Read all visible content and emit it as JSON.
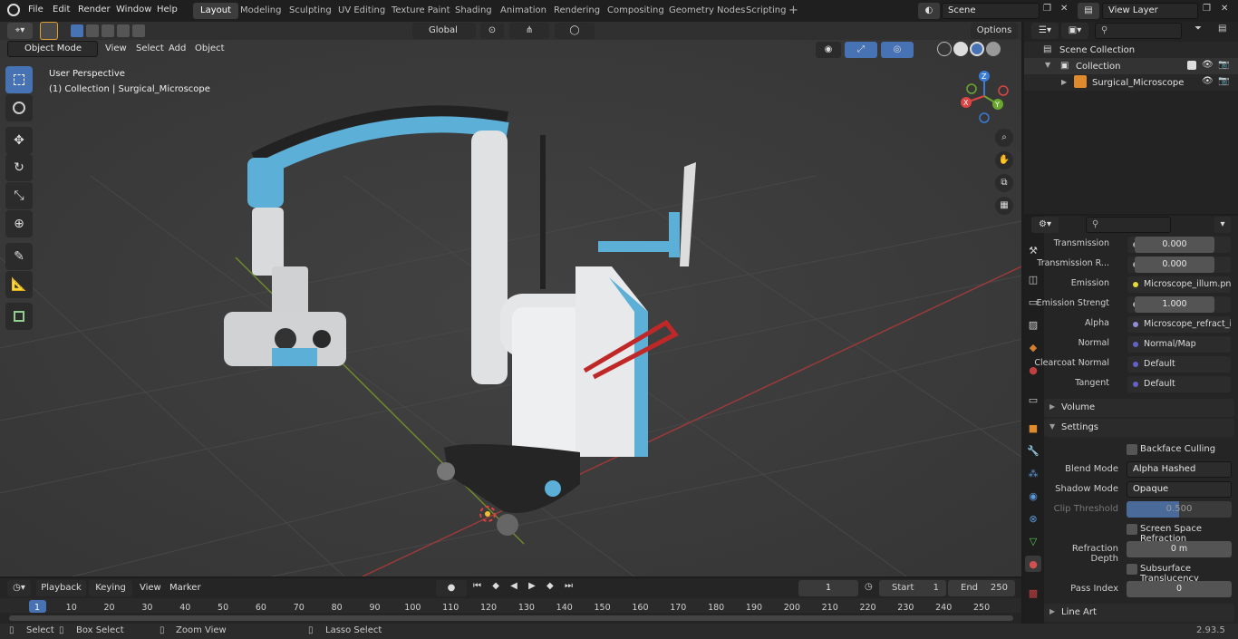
{
  "menus": [
    "File",
    "Edit",
    "Render",
    "Window",
    "Help"
  ],
  "workspaces": [
    "Layout",
    "Modeling",
    "Sculpting",
    "UV Editing",
    "Texture Paint",
    "Shading",
    "Animation",
    "Rendering",
    "Compositing",
    "Geometry Nodes",
    "Scripting"
  ],
  "scene": "Scene",
  "view_layer": "View Layer",
  "vp": {
    "mode": "Object Mode",
    "view": "View",
    "select": "Select",
    "add": "Add",
    "object": "Object",
    "orientation": "Global",
    "options": "Options",
    "overlay_title": "User Perspective",
    "overlay_sub": "(1) Collection | Surgical_Microscope"
  },
  "gizmo": {
    "x": "X",
    "y": "Y",
    "z": "Z"
  },
  "outliner": {
    "scene_collection": "Scene Collection",
    "collection": "Collection",
    "object": "Surgical_Microscope"
  },
  "props": {
    "rows": [
      {
        "label": "Transmission",
        "value": "0.000",
        "type": "num"
      },
      {
        "label": "Transmission R...",
        "value": "0.000",
        "type": "num"
      },
      {
        "label": "Emission",
        "value": "Microscope_illum.png",
        "type": "link",
        "color": "#e6d93a"
      },
      {
        "label": "Emission Strengt",
        "value": "1.000",
        "type": "num"
      },
      {
        "label": "Alpha",
        "value": "Microscope_refract_i...",
        "type": "link",
        "color": "#8f8fd6"
      },
      {
        "label": "Normal",
        "value": "Normal/Map",
        "type": "link",
        "color": "#6363c7"
      },
      {
        "label": "Clearcoat Normal",
        "value": "Default",
        "type": "link",
        "color": "#6363c7"
      },
      {
        "label": "Tangent",
        "value": "Default",
        "type": "link",
        "color": "#6363c7"
      }
    ],
    "volume": "Volume",
    "settings": "Settings",
    "backface": "Backface Culling",
    "blend_label": "Blend Mode",
    "blend": "Alpha Hashed",
    "shadow_label": "Shadow Mode",
    "shadow": "Opaque",
    "clip_label": "Clip Threshold",
    "clip": "0.500",
    "ssr": "Screen Space Refraction",
    "refr_label": "Refraction Depth",
    "refr": "0 m",
    "sss": "Subsurface Translucency",
    "pass_label": "Pass Index",
    "pass": "0",
    "lineart": "Line Art"
  },
  "timeline": {
    "playback": "Playback",
    "keying": "Keying",
    "view": "View",
    "marker": "Marker",
    "frame": "1",
    "start_label": "Start",
    "start": "1",
    "end_label": "End",
    "end": "250",
    "ticks": [
      "1",
      "10",
      "20",
      "30",
      "40",
      "50",
      "60",
      "70",
      "80",
      "90",
      "100",
      "110",
      "120",
      "130",
      "140",
      "150",
      "160",
      "170",
      "180",
      "190",
      "200",
      "210",
      "220",
      "230",
      "240",
      "250"
    ]
  },
  "status": {
    "select": "Select",
    "box": "Box Select",
    "zoom": "Zoom View",
    "lasso": "Lasso Select",
    "version": "2.93.5"
  }
}
